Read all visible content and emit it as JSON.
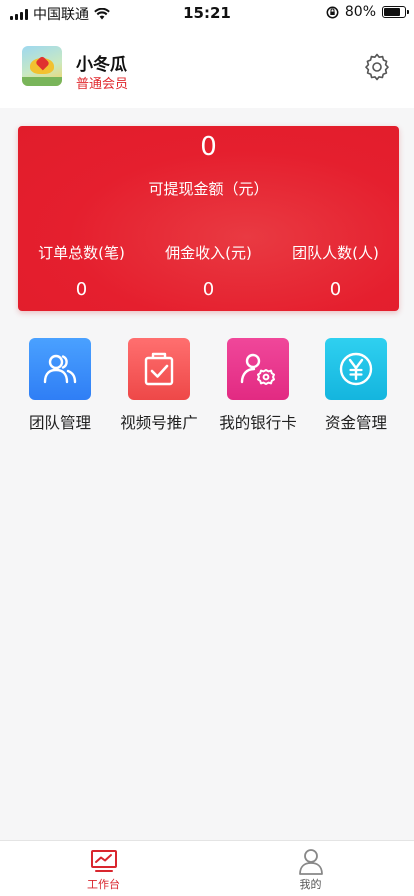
{
  "status_bar": {
    "carrier": "中国联通",
    "time": "15:21",
    "battery_percent": "80%",
    "battery_level": 0.8
  },
  "profile": {
    "name": "小冬瓜",
    "membership": "普通会员"
  },
  "balance_card": {
    "withdrawable_amount": "0",
    "withdrawable_label": "可提现金额（元）",
    "stats": [
      {
        "label": "订单总数(笔)",
        "value": "0"
      },
      {
        "label": "佣金收入(元)",
        "value": "0"
      },
      {
        "label": "团队人数(人)",
        "value": "0"
      }
    ]
  },
  "shortcuts": [
    {
      "label": "团队管理",
      "icon": "team-icon"
    },
    {
      "label": "视频号推广",
      "icon": "clipboard-check-icon"
    },
    {
      "label": "我的银行卡",
      "icon": "user-settings-icon"
    },
    {
      "label": "资金管理",
      "icon": "yuan-coin-icon"
    }
  ],
  "tabbar": {
    "tabs": [
      {
        "label": "工作台",
        "icon": "dashboard-chart-icon",
        "active": true
      },
      {
        "label": "我的",
        "icon": "person-icon",
        "active": false
      }
    ]
  },
  "colors": {
    "brand_red": "#e51f2e",
    "member_red": "#e0292e"
  }
}
